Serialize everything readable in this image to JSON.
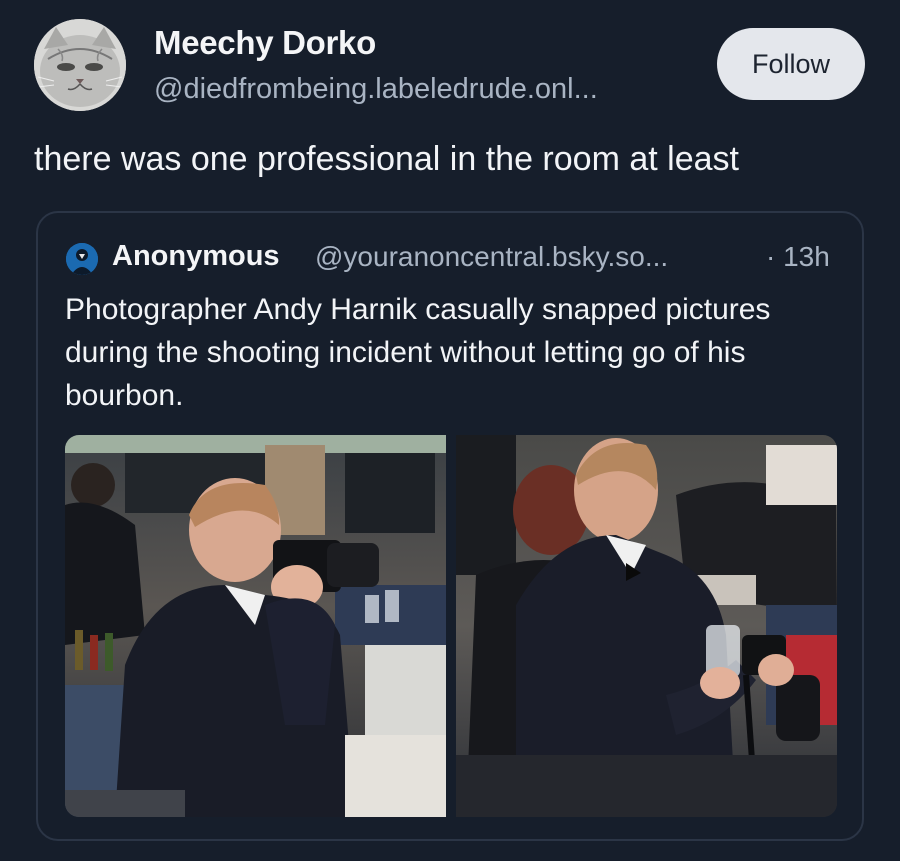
{
  "author": {
    "display_name": "Meechy Dorko",
    "handle": "@diedfrombeing.labeledrude.onl...",
    "avatar_icon": "cat-avatar"
  },
  "follow_button": {
    "label": "Follow"
  },
  "post": {
    "text": "there was one professional in the room at least"
  },
  "quote": {
    "author_name": "Anonymous",
    "author_handle": "@youranoncentral.bsky.so...",
    "time": "· 13h",
    "avatar_icon": "anonymous-avatar",
    "text": "Photographer Andy Harnik casually snapped pictures during the shooting incident without letting go of his bourbon.",
    "images": [
      "photographer-with-camera-photo",
      "photographer-holding-glass-photo"
    ]
  },
  "colors": {
    "background": "#161e2b",
    "card_border": "#2b3546",
    "follow_bg": "#e4e7ec",
    "secondary_text": "#a9b4c3"
  }
}
